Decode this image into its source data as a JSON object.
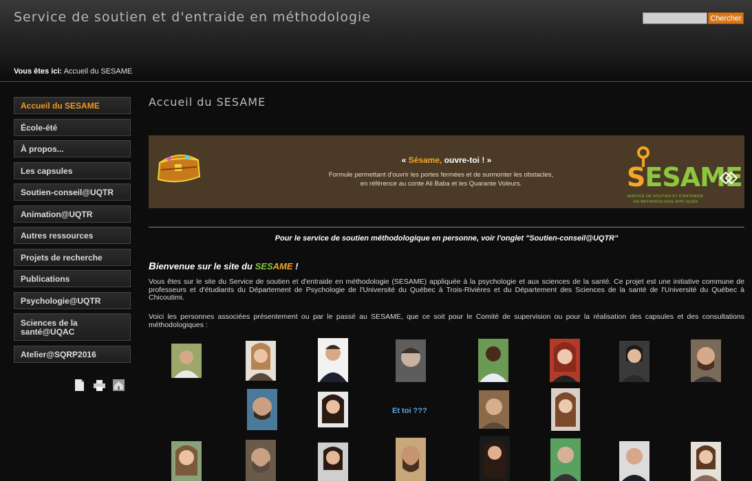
{
  "header": {
    "site_title": "Service de soutien et d'entraide en méthodologie",
    "search_placeholder": "",
    "search_button": "Chercher"
  },
  "breadcrumb": {
    "label": "Vous êtes ici:",
    "current": "Accueil du SESAME"
  },
  "sidebar": {
    "items": [
      {
        "label": "Accueil du SESAME",
        "active": true
      },
      {
        "label": "École-été"
      },
      {
        "label": "À propos..."
      },
      {
        "label": "Les capsules"
      },
      {
        "label": "Soutien-conseil@UQTR"
      },
      {
        "label": "Animation@UQTR"
      },
      {
        "label": "Autres ressources"
      },
      {
        "label": "Projets de recherche"
      },
      {
        "label": "Publications"
      },
      {
        "label": "Psychologie@UQTR"
      },
      {
        "label": "Sciences de la santé@UQAC"
      },
      {
        "label": "Atelier@SQRP2016"
      }
    ],
    "tools": [
      "document-icon",
      "print-icon",
      "home-icon"
    ]
  },
  "main": {
    "page_title": "Accueil du SESAME",
    "banner": {
      "headline_open": "« ",
      "headline_accent": "Sésame,",
      "headline_rest": " ouvre-toi ! »",
      "line1": "Formule permettant d'ouvrir les portes fermées et de surmonter les obstacles,",
      "line2": "en référence au conte Ali Baba et les Quarante Voleurs.",
      "logo_s": "S",
      "logo_rest": "ESAME",
      "logo_sub1": "SERVICE DE SOUTIEN ET D'ENTRAIDE",
      "logo_sub2": "EN MÉTHODOLOGIE APPLIQUÉE"
    },
    "notice": "Pour le service de soutien méthodologique en personne, voir l'onglet \"Soutien-conseil@UQTR\"",
    "welcome": {
      "first_letter": "B",
      "text": "ienvenue sur le site du ",
      "brand_a": "SES",
      "brand_b": "AME",
      "end": " !"
    },
    "paragraph1": "Vous êtes sur le site du Service de soutien et d'entraide en méthodologie (SESAME) appliquée à la psychologie et aux sciences de la santé. Ce projet est une initiative commune de professeurs et d'étudiants du Département de Psychologie de l'Université du Québec à Trois-Rivières et du Département des Sciences de la santé de l'Université du Québec à Chicoutimi.",
    "paragraph2": "Voici les personnes associées présentement ou par le passé au SESAME, que ce soit pour le Comité de supervision ou pour la réalisation des capsules et des consultations méthodologiques :",
    "invite": "Et toi ???"
  },
  "colors": {
    "accent": "#f39a26",
    "logo_green": "#8dc63f",
    "logo_orange": "#f5a623",
    "invite": "#5aa8d8"
  }
}
